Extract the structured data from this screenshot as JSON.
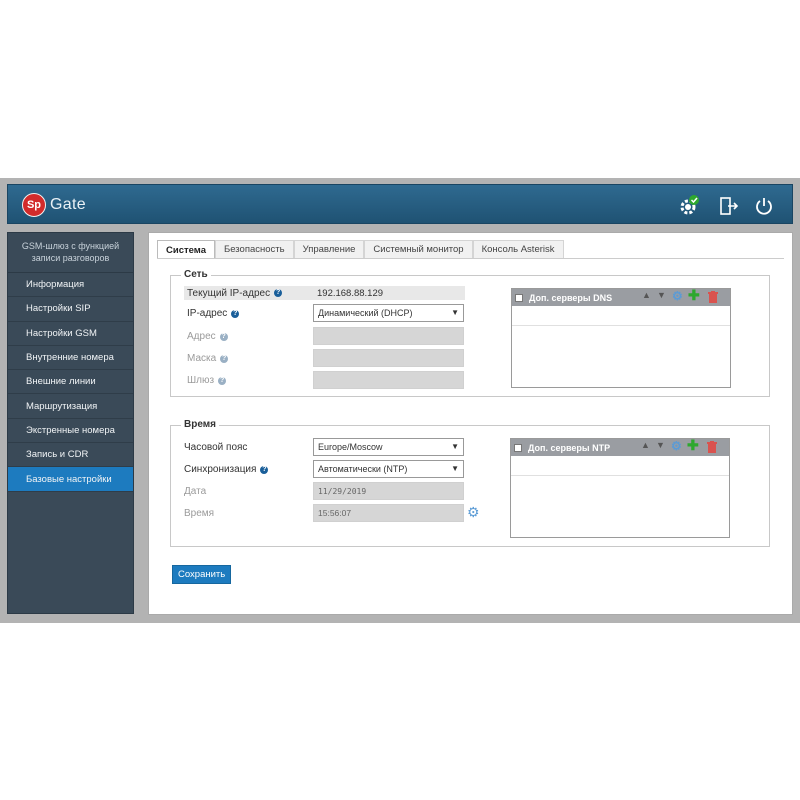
{
  "app": {
    "logo_badge": "Sp",
    "logo_text": "Gate"
  },
  "header_icons": [
    "settings-ok-icon",
    "logout-icon",
    "power-icon"
  ],
  "sidebar": {
    "header": "GSM-шлюз с функцией записи разговоров",
    "items": [
      {
        "label": "Информация"
      },
      {
        "label": "Настройки SIP"
      },
      {
        "label": "Настройки GSM"
      },
      {
        "label": "Внутренние номера"
      },
      {
        "label": "Внешние линии"
      },
      {
        "label": "Маршрутизация"
      },
      {
        "label": "Экстренные номера"
      },
      {
        "label": "Запись и CDR"
      },
      {
        "label": "Базовые настройки"
      }
    ],
    "active_index": 8
  },
  "tabs": [
    {
      "label": "Система"
    },
    {
      "label": "Безопасность"
    },
    {
      "label": "Управление"
    },
    {
      "label": "Системный монитор"
    },
    {
      "label": "Консоль Asterisk"
    }
  ],
  "network": {
    "legend": "Сеть",
    "current_ip_label": "Текущий IP-адрес",
    "current_ip_value": "192.168.88.129",
    "ip_mode_label": "IP-адрес",
    "ip_mode_value": "Динамический (DHCP)",
    "address_label": "Адрес",
    "mask_label": "Маска",
    "gateway_label": "Шлюз",
    "dns_title": "Доп. серверы DNS"
  },
  "time": {
    "legend": "Время",
    "timezone_label": "Часовой пояс",
    "timezone_value": "Europe/Moscow",
    "sync_label": "Синхронизация",
    "sync_value": "Автоматически (NTP)",
    "date_label": "Дата",
    "date_value": "11/29/2019",
    "time_label": "Время",
    "time_value": "15:56:07",
    "ntp_title": "Доп. серверы NTP"
  },
  "save_label": "Сохранить",
  "colors": {
    "accent": "#1d7bbf",
    "header": "#2a6389",
    "sidebar": "#3a4a58",
    "add": "#2ea82e",
    "delete": "#d9534f",
    "gear": "#5b9bd5"
  }
}
